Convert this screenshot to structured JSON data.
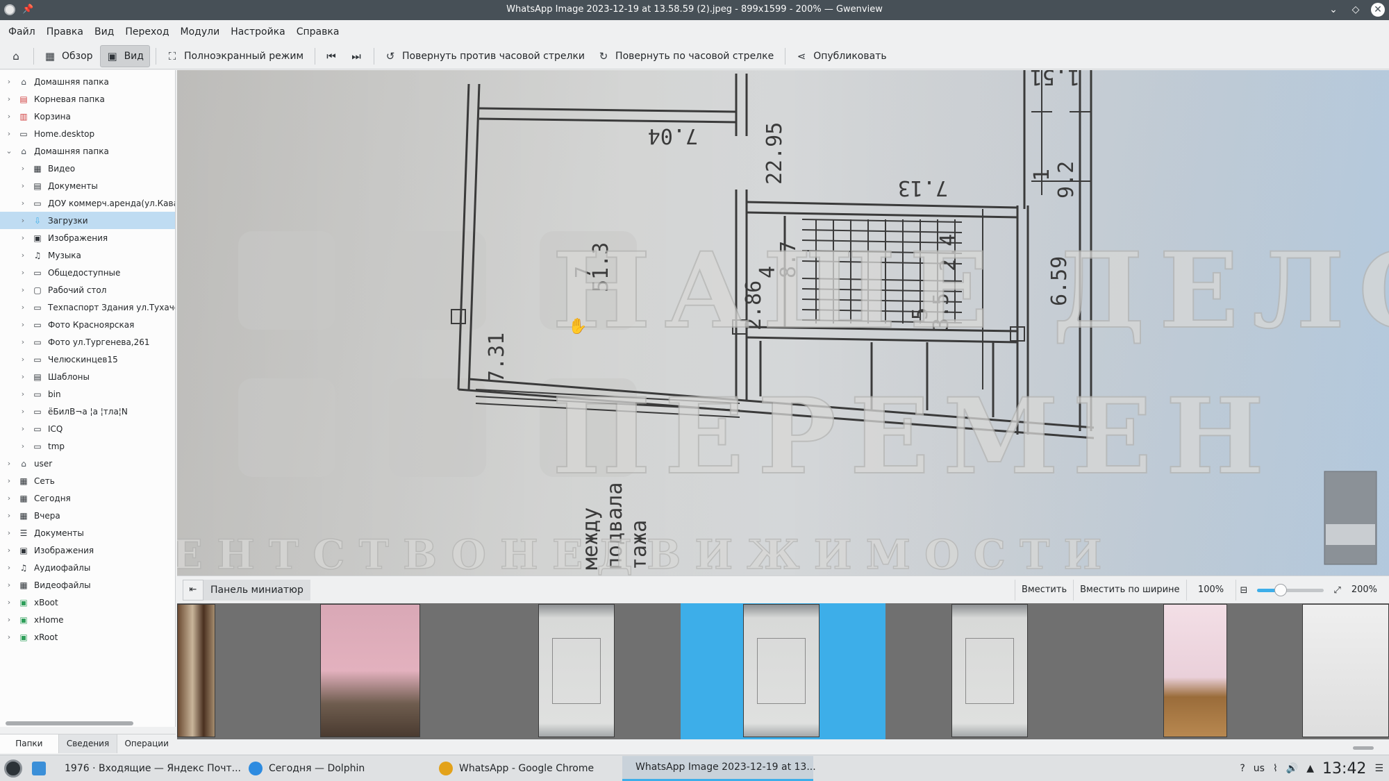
{
  "window": {
    "title": "WhatsApp Image 2023-12-19 at 13.58.59 (2).jpeg - 899x1599 - 200% — Gwenview"
  },
  "menu": [
    "Файл",
    "Правка",
    "Вид",
    "Переход",
    "Модули",
    "Настройка",
    "Справка"
  ],
  "toolbar": {
    "browse": "Обзор",
    "view": "Вид",
    "fullscreen": "Полноэкранный режим",
    "rotate_left": "Повернуть против часовой стрелки",
    "rotate_right": "Повернуть по часовой стрелке",
    "share": "Опубликовать"
  },
  "sidebar": {
    "tree": [
      {
        "label": "Домашняя папка",
        "icon": "home-icon",
        "level": 0,
        "expanded": false
      },
      {
        "label": "Корневая папка",
        "icon": "root-folder-icon",
        "level": 0,
        "expanded": false
      },
      {
        "label": "Корзина",
        "icon": "trash-icon",
        "level": 0,
        "expanded": false
      },
      {
        "label": "Home.desktop",
        "icon": "desktop-file-icon",
        "level": 0,
        "expanded": false
      },
      {
        "label": "Домашняя папка",
        "icon": "home-icon",
        "level": 0,
        "expanded": true
      },
      {
        "label": "Видео",
        "icon": "video-folder-icon",
        "level": 1
      },
      {
        "label": "Документы",
        "icon": "documents-folder-icon",
        "level": 1
      },
      {
        "label": "ДОУ коммерч.аренда(ул.Кавалер",
        "icon": "folder-icon",
        "level": 1
      },
      {
        "label": "Загрузки",
        "icon": "downloads-folder-icon",
        "level": 1,
        "selected": true
      },
      {
        "label": "Изображения",
        "icon": "pictures-folder-icon",
        "level": 1
      },
      {
        "label": "Музыка",
        "icon": "music-folder-icon",
        "level": 1
      },
      {
        "label": "Общедоступные",
        "icon": "folder-icon",
        "level": 1
      },
      {
        "label": "Рабочий стол",
        "icon": "desktop-folder-icon",
        "level": 1
      },
      {
        "label": "Техпаспорт Здания ул.Тухачевск",
        "icon": "folder-icon",
        "level": 1
      },
      {
        "label": "Фото Красноярская",
        "icon": "folder-icon",
        "level": 1
      },
      {
        "label": "Фото ул.Тургенева,261",
        "icon": "folder-icon",
        "level": 1
      },
      {
        "label": "Челюскинцев15",
        "icon": "folder-icon",
        "level": 1
      },
      {
        "label": "Шаблоны",
        "icon": "templates-folder-icon",
        "level": 1
      },
      {
        "label": "bin",
        "icon": "folder-icon",
        "level": 1
      },
      {
        "label": "ёБилВ¬а ¦а ¦тла¦N",
        "icon": "folder-icon",
        "level": 1
      },
      {
        "label": "ICQ",
        "icon": "folder-icon",
        "level": 1
      },
      {
        "label": "tmp",
        "icon": "folder-icon",
        "level": 1
      },
      {
        "label": "user",
        "icon": "home-icon",
        "level": 0
      },
      {
        "label": "Сеть",
        "icon": "network-icon",
        "level": 0
      },
      {
        "label": "Сегодня",
        "icon": "calendar-icon",
        "level": 0
      },
      {
        "label": "Вчера",
        "icon": "calendar-icon",
        "level": 0
      },
      {
        "label": "Документы",
        "icon": "documents-icon",
        "level": 0
      },
      {
        "label": "Изображения",
        "icon": "pictures-icon",
        "level": 0
      },
      {
        "label": "Аудиофайлы",
        "icon": "music-icon",
        "level": 0
      },
      {
        "label": "Видеофайлы",
        "icon": "video-icon",
        "level": 0
      },
      {
        "label": "xBoot",
        "icon": "drive-icon",
        "level": 0
      },
      {
        "label": "xHome",
        "icon": "drive-icon",
        "level": 0
      },
      {
        "label": "xRoot",
        "icon": "drive-icon",
        "level": 0
      }
    ],
    "tabs": [
      "Папки",
      "Сведения",
      "Операции"
    ]
  },
  "image": {
    "dimensions": [
      "7.04",
      "22.95",
      "7.13",
      "1",
      "9.2",
      "1.51",
      "7",
      "51.3",
      "2.86",
      "4",
      "8.7",
      "2.4",
      "5",
      "3.5",
      "6.59",
      "7.31",
      "между",
      "подвала",
      "тажа"
    ],
    "watermark": {
      "line1": "НАШЕ ДЕЛО",
      "line2": "ПЕРЕМЕН",
      "line3": "А Г Е Н Т С Т В О   Н Е Д В И Ж И М О С Т И"
    }
  },
  "zoombar": {
    "thumb_panel": "Панель миниатюр",
    "fit": "Вместить",
    "fit_width": "Вместить по ширине",
    "zoom_100": "100%",
    "zoom_current": "200%",
    "slider_level": 0.35
  },
  "thumbnails": [
    {
      "kind": "photo-door",
      "selected": false
    },
    {
      "kind": "photo-room",
      "selected": false
    },
    {
      "kind": "plan-photo",
      "selected": false
    },
    {
      "kind": "plan-photo",
      "selected": true
    },
    {
      "kind": "plan-photo",
      "selected": false
    },
    {
      "kind": "plan-color",
      "selected": false
    },
    {
      "kind": "document",
      "selected": false
    }
  ],
  "taskbar": {
    "items": [
      {
        "label": "1976 · Входящие — Яндекс Почт...",
        "icon": "yandex-browser-icon",
        "color": "#3b8fd8"
      },
      {
        "label": "Сегодня — Dolphin",
        "icon": "dolphin-icon",
        "color": "#2d8be0"
      },
      {
        "label": "WhatsApp - Google Chrome",
        "icon": "chrome-icon",
        "color": "#e3a21a"
      },
      {
        "label": "WhatsApp Image 2023-12-19 at 13...",
        "icon": "gwenview-icon",
        "color": "#d03a7c",
        "active": true
      }
    ],
    "keyboard_layout": "us",
    "clock": "13:42"
  },
  "colors": {
    "accent": "#3daee9",
    "titlebar": "#475057",
    "selection": "#bfdcf2"
  }
}
